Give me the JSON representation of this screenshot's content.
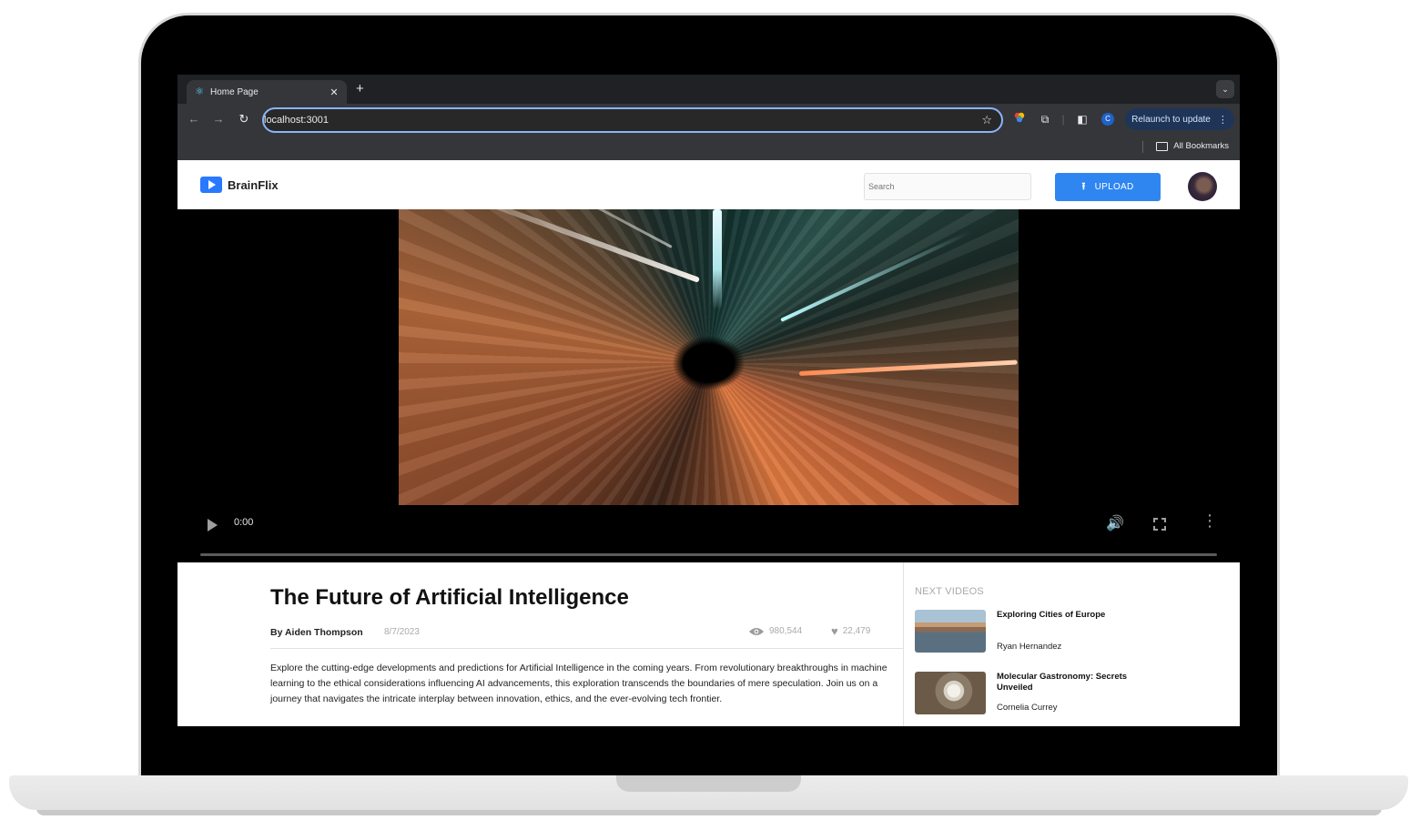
{
  "browser": {
    "tab_title": "Home Page",
    "url": "localhost:3001",
    "profile_initial": "C",
    "relaunch_label": "Relaunch to update",
    "bookmarks_label": "All Bookmarks"
  },
  "site": {
    "brand": "BrainFlix",
    "search_placeholder": "Search",
    "upload_label": "UPLOAD"
  },
  "player": {
    "current_time": "0:00",
    "progress": 0
  },
  "video": {
    "title": "The Future of Artificial Intelligence",
    "author": "By Aiden Thompson",
    "date": "8/7/2023",
    "views": "980,544",
    "likes": "22,479",
    "description": "Explore the cutting-edge developments and predictions for Artificial Intelligence in the coming years. From revolutionary breakthroughs in machine learning to the ethical considerations influencing AI advancements, this exploration transcends the boundaries of mere speculation. Join us on a journey that navigates the intricate interplay between innovation, ethics, and the ever-evolving tech frontier."
  },
  "next_videos": {
    "heading": "NEXT VIDEOS",
    "items": [
      {
        "title": "Exploring Cities of Europe",
        "channel": "Ryan Hernandez"
      },
      {
        "title": "Molecular Gastronomy: Secrets Unveiled",
        "channel": "Cornelia Currey"
      }
    ]
  },
  "colors": {
    "accent": "#2f86f0",
    "omnibox_focus": "#8ab4f8",
    "chrome_dark": "#35363a"
  }
}
